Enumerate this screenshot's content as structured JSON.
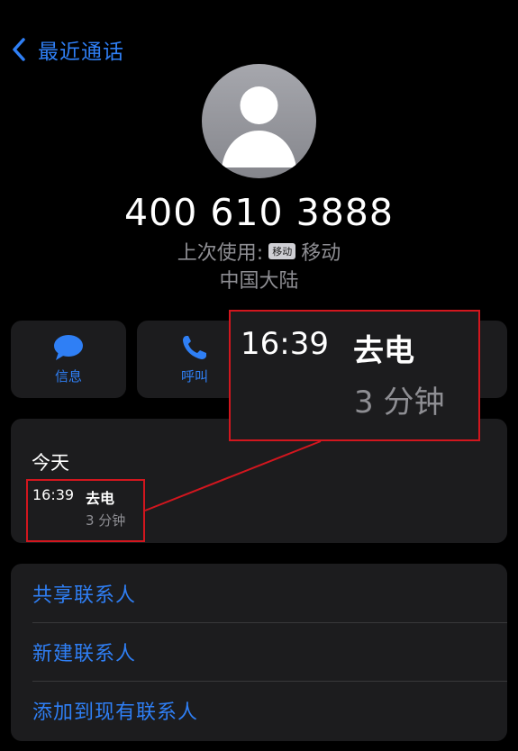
{
  "header": {
    "back_label": "最近通话"
  },
  "contact": {
    "number": "400 610 3888",
    "last_used_label": "上次使用:",
    "carrier_badge": "移动",
    "carrier": "移动",
    "region": "中国大陆"
  },
  "actions": [
    {
      "label": "信息",
      "icon": "message-icon"
    },
    {
      "label": "呼叫",
      "icon": "phone-icon"
    }
  ],
  "history": {
    "day": "今天",
    "entries": [
      {
        "time": "16:39",
        "type": "去电",
        "duration": "3 分钟"
      }
    ]
  },
  "zoom_callout": {
    "time": "16:39",
    "type": "去电",
    "duration": "3 分钟"
  },
  "options": [
    "共享联系人",
    "新建联系人",
    "添加到现有联系人"
  ],
  "colors": {
    "accent": "#2f7ff5",
    "highlight": "#d2161e",
    "card": "#1c1c1e",
    "secondary": "#8e8e93"
  }
}
